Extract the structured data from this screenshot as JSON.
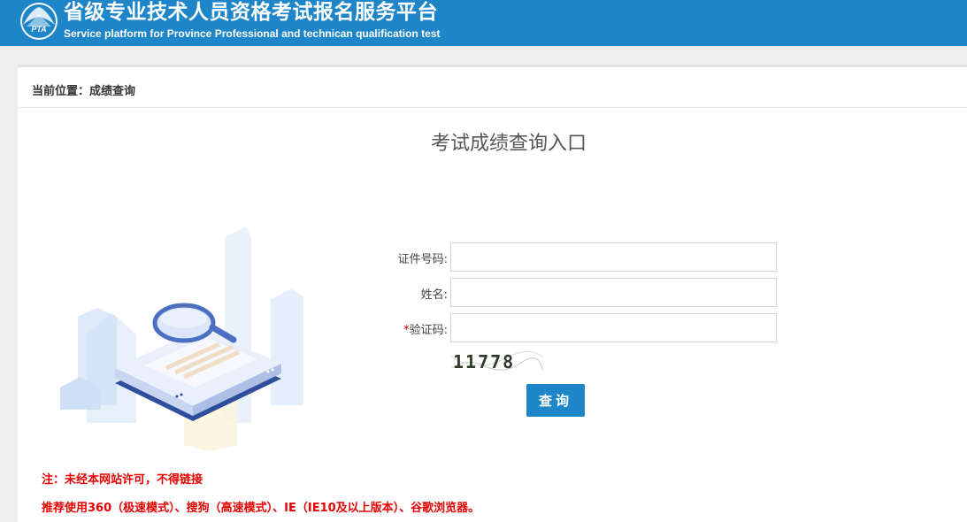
{
  "header": {
    "logo_text": "PTA",
    "title": "省级专业技术人员资格考试报名服务平台",
    "subtitle": "Service platform for Province Professional and technican qualification test"
  },
  "breadcrumb": {
    "text": "当前位置：成绩查询"
  },
  "main": {
    "title": "考试成绩查询入口"
  },
  "form": {
    "id_label": "证件号码:",
    "id_value": "",
    "name_label": "姓名:",
    "name_value": "",
    "captcha_required_mark": "*",
    "captcha_label": "验证码:",
    "captcha_value": "",
    "captcha_image_text": "11778",
    "submit_label": "查询"
  },
  "notices": {
    "line1": "注：未经本网站许可，不得链接",
    "line2": "推荐使用360（极速模式）、搜狗（高速模式）、IE（IE10及以上版本）、谷歌浏览器。"
  },
  "colors": {
    "brand_blue": "#1e86c8",
    "notice_red": "#e60000"
  }
}
